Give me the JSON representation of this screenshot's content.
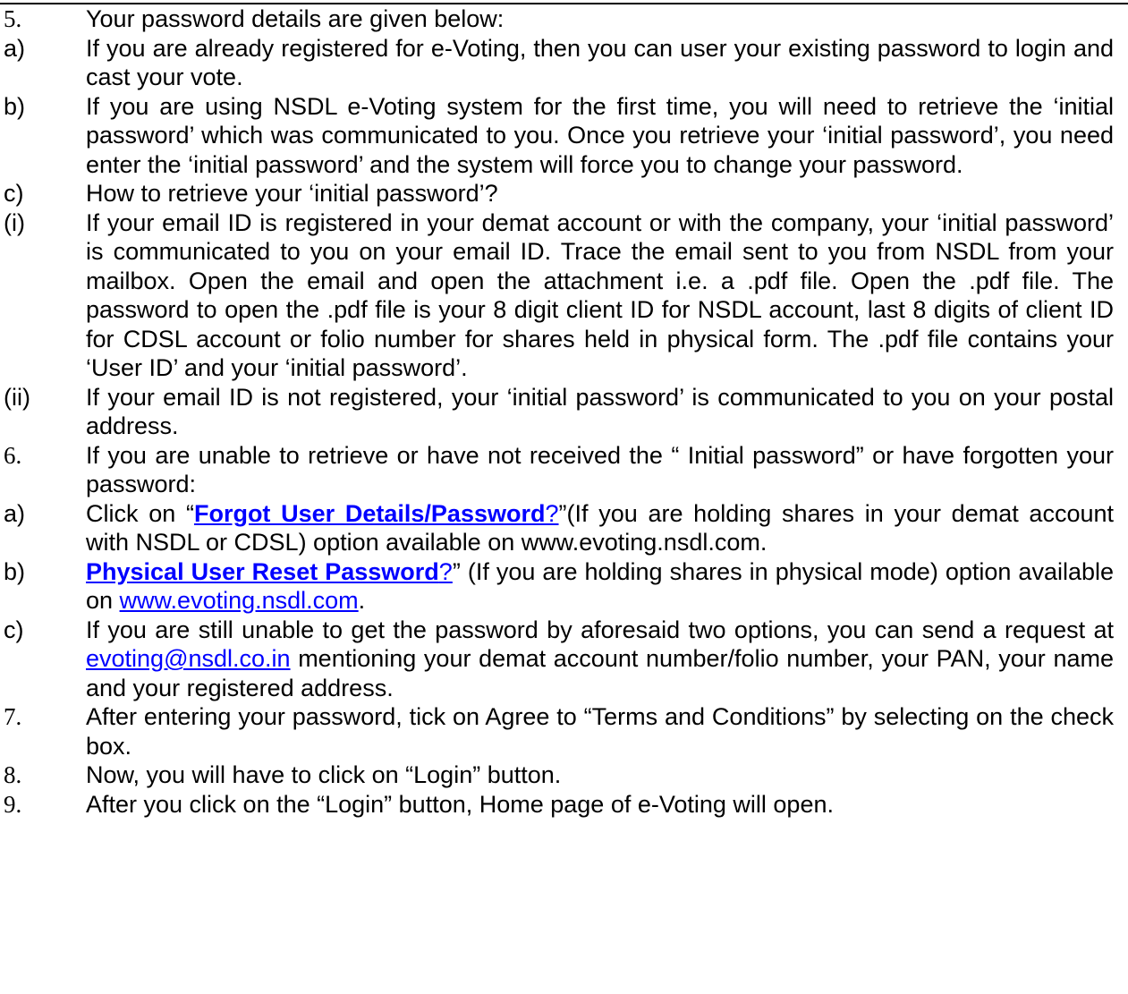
{
  "items": [
    {
      "marker": "5.",
      "text": "Your password details are given below:"
    },
    {
      "marker": "a)",
      "text": "If you are already registered for e-Voting, then you can user your existing password to login and cast your vote."
    },
    {
      "marker": "b)",
      "text": "If you are using NSDL e-Voting system for the first time, you will need to retrieve the ‘initial password’ which was communicated to you. Once you retrieve your ‘initial password’, you need enter the ‘initial password’ and the system will force you to change your password."
    },
    {
      "marker": "c)",
      "text": "How to retrieve your ‘initial password’?"
    },
    {
      "marker": "(i)",
      "text": "If your email ID is registered in your demat account or with the company, your ‘initial password’ is communicated to you on your email ID. Trace the email sent to you from NSDL from your mailbox. Open the email and open the attachment i.e. a .pdf file. Open the .pdf file. The password to open the .pdf file is your 8 digit client ID for NSDL account, last 8 digits of client ID for CDSL account or folio number for shares held in physical form. The .pdf file contains your ‘User ID’ and your ‘initial password’."
    },
    {
      "marker": "(ii)",
      "text": "If your email ID is not registered, your ‘initial password’ is communicated to you on your postal address."
    },
    {
      "marker": "6.",
      "text": "If you are unable to retrieve or have not received the “ Initial password” or have forgotten your password:"
    },
    {
      "marker": "a)",
      "prefix": " Click on “",
      "link": "Forgot User Details/Password",
      "link2": "?",
      "suffix": "”(If you are holding shares in your demat account with NSDL or CDSL) option available on www.evoting.nsdl.com."
    },
    {
      "marker": "b)",
      "link": "Physical User Reset Password",
      "link2": "?",
      "suffix": "” (If you are holding shares in physical mode) option available on ",
      "url": "www.evoting.nsdl.com",
      "end": "."
    },
    {
      "marker": "c)",
      "prefix": "If you are still unable to get the password by aforesaid two options, you can send a request at ",
      "email": "evoting@nsdl.co.in",
      "suffix": " mentioning your demat account number/folio number, your PAN, your name and your registered address."
    },
    {
      "marker": "7.",
      "text": "After entering your password, tick on Agree to “Terms and Conditions” by selecting on the check box."
    },
    {
      "marker": "8.",
      "text": "Now, you will have to click on “Login” button."
    },
    {
      "marker": "9.",
      "text": "After you click on the “Login” button, Home page of e-Voting will open."
    }
  ]
}
